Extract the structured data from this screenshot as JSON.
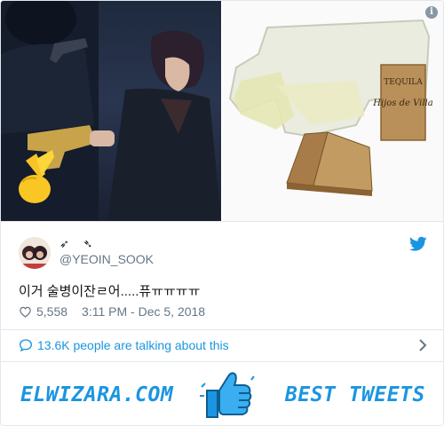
{
  "tweet": {
    "display_name": "➶ ➴",
    "handle": "@YEOIN_SOOK",
    "text": "이거 술병이잔ㄹ어.....퓨ㅠㅠㅠㅠ",
    "likes": "5,558",
    "timestamp": "3:11 PM - Dec 5, 2018",
    "talking_label": "13.6K people are talking about this"
  },
  "media": {
    "left_description_icon": "crossed-fingers-emoji",
    "right_label_top": "TEQUILA",
    "right_label_script": "Hijos de Villa"
  },
  "info_icon": "i",
  "footer": {
    "site": "ELWIZARA.COM",
    "tagline": "BEST TWEETS"
  },
  "colors": {
    "twitter_blue": "#1b95e0",
    "text": "#14171a",
    "muted": "#657786",
    "border": "#e1e8ed"
  }
}
